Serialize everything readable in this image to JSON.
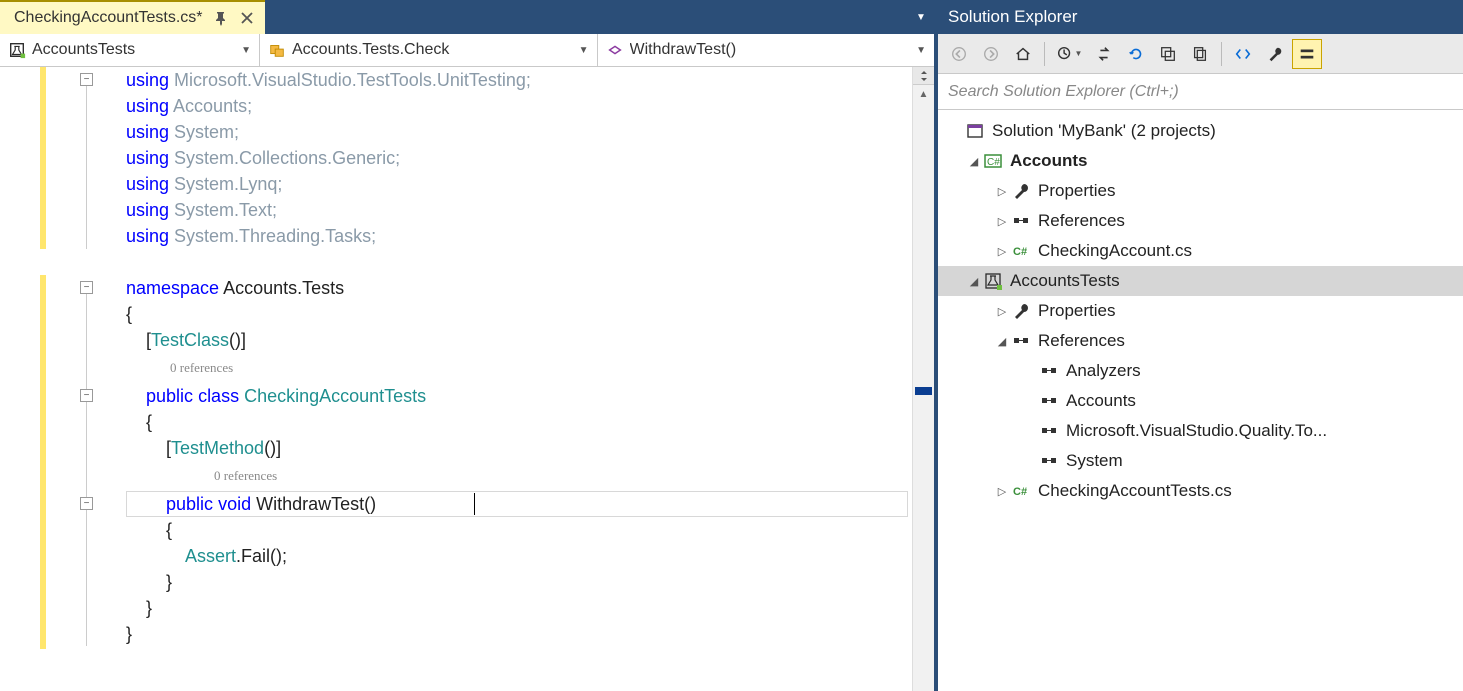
{
  "tab": {
    "label": "CheckingAccountTests.cs*"
  },
  "nav": {
    "scope": "AccountsTests",
    "class": "Accounts.Tests.Check",
    "member": "WithdrawTest()"
  },
  "refs": {
    "zero": "0 references"
  },
  "code": {
    "l1a": "using",
    "l1b": " Microsoft.VisualStudio.TestTools.UnitTesting;",
    "l2a": "using",
    "l2b": " Accounts;",
    "l3a": "using",
    "l3b": " System;",
    "l4a": "using",
    "l4b": " System.Collections.Generic;",
    "l5a": "using",
    "l5b": " System.Lynq;",
    "l6a": "using",
    "l6b": " System.Text;",
    "l7a": "using",
    "l7b": " System.Threading.Tasks;",
    "l9a": "namespace",
    "l9b": " Accounts.Tests",
    "l10": "{",
    "l11a": "    [",
    "l11b": "TestClass",
    "l11c": "()]",
    "l12a": "    ",
    "l12b": "public",
    "l12c": " ",
    "l12d": "class",
    "l12e": " ",
    "l12f": "CheckingAccountTests",
    "l13": "    {",
    "l14a": "        [",
    "l14b": "TestMethod",
    "l14c": "()]",
    "l15a": "        ",
    "l15b": "public",
    "l15c": " ",
    "l15d": "void",
    "l15e": " WithdrawTest()",
    "l16": "        {",
    "l17a": "            ",
    "l17b": "Assert",
    "l17c": ".Fail();",
    "l18": "        }",
    "l19": "    }",
    "l20": "}"
  },
  "sol": {
    "title": "Solution Explorer",
    "search_placeholder": "Search Solution Explorer (Ctrl+;)",
    "root": "Solution 'MyBank' (2 projects)",
    "proj1": "Accounts",
    "p1_props": "Properties",
    "p1_refs": "References",
    "p1_file": "CheckingAccount.cs",
    "proj2": "AccountsTests",
    "p2_props": "Properties",
    "p2_refs": "References",
    "p2_r1": "Analyzers",
    "p2_r2": "Accounts",
    "p2_r3": "Microsoft.VisualStudio.Quality.To...",
    "p2_r4": "System",
    "p2_file": "CheckingAccountTests.cs"
  }
}
